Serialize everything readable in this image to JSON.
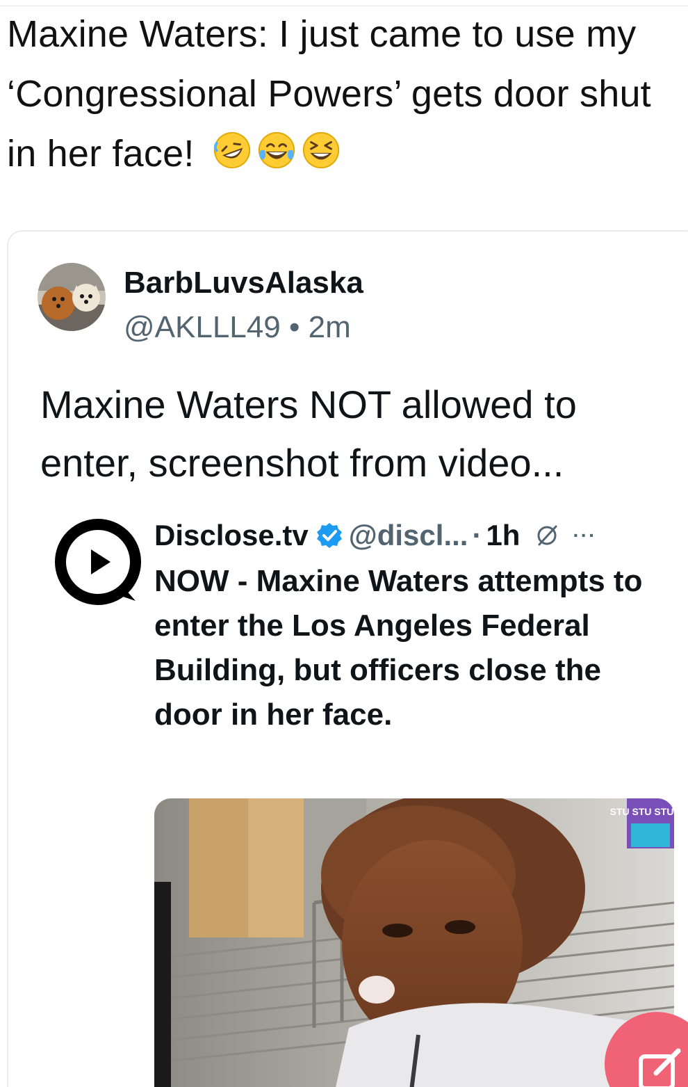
{
  "post": {
    "text": "Maxine Waters: I just came to use my ‘Congressional Powers’ gets door shut in her face!",
    "emojis": [
      "rolling-on-floor-laughing-emoji",
      "tears-of-joy-emoji",
      "grinning-squinting-emoji"
    ]
  },
  "quoted_post": {
    "display_name": "BarbLuvsAlaska",
    "handle": "@AKLLL49",
    "separator": "•",
    "time": "2m",
    "text": "Maxine Waters NOT allowed to enter, screenshot from video..."
  },
  "embedded_post": {
    "name": "Disclose.tv",
    "handle": "@discl...",
    "dot": "·",
    "time": "1h",
    "more": "···",
    "text": "NOW - Maxine Waters attempts to enter the Los Angeles Federal Building, but officers close the door in her face.",
    "watermark": "STU STU STUDIO"
  },
  "colors": {
    "accent_verified": "#1d9bf0",
    "fab": "#f06377",
    "muted": "#536471"
  },
  "icons": {
    "avatar": "dog-avatar",
    "embed_logo": "disclose-tv-logo",
    "verified": "verified-badge-icon",
    "grok": "grok-icon",
    "compose": "compose-icon"
  }
}
